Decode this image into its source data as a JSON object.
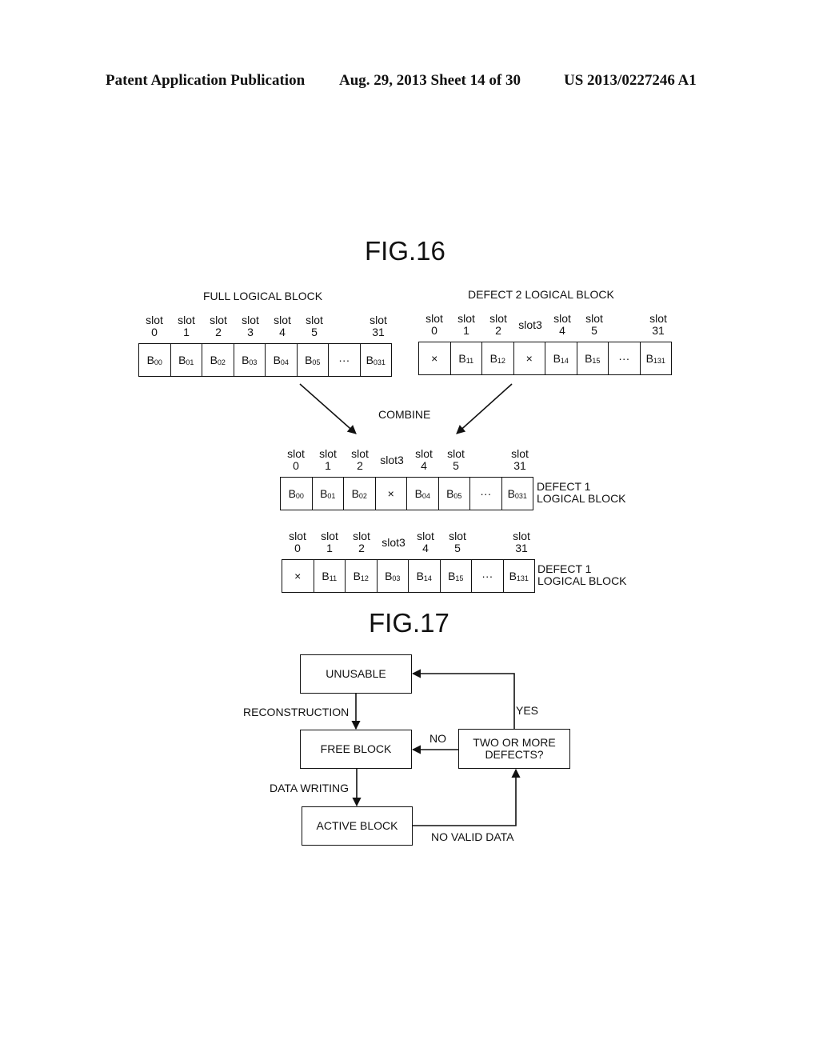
{
  "header": {
    "publication": "Patent Application Publication",
    "date_sheet": "Aug. 29, 2013  Sheet 14 of 30",
    "number": "US 2013/0227246 A1"
  },
  "fig16": {
    "title": "FIG.16",
    "combine_label": "COMBINE",
    "full_block": {
      "title": "FULL LOGICAL BLOCK",
      "slots": [
        [
          "slot",
          "0"
        ],
        [
          "slot",
          "1"
        ],
        [
          "slot",
          "2"
        ],
        [
          "slot",
          "3"
        ],
        [
          "slot",
          "4"
        ],
        [
          "slot",
          "5"
        ],
        [
          "",
          ""
        ],
        [
          "slot",
          "31"
        ]
      ],
      "cells": [
        [
          "B",
          "00"
        ],
        [
          "B",
          "01"
        ],
        [
          "B",
          "02"
        ],
        [
          "B",
          "03"
        ],
        [
          "B",
          "04"
        ],
        [
          "B",
          "05"
        ],
        [
          "···",
          ""
        ],
        [
          "B",
          "031"
        ]
      ]
    },
    "defect2_block": {
      "title": "DEFECT 2 LOGICAL BLOCK",
      "slots": [
        [
          "slot",
          "0"
        ],
        [
          "slot",
          "1"
        ],
        [
          "slot",
          "2"
        ],
        [
          "slot3",
          ""
        ],
        [
          "slot",
          "4"
        ],
        [
          "slot",
          "5"
        ],
        [
          "",
          ""
        ],
        [
          "slot",
          "31"
        ]
      ],
      "cells": [
        [
          "×",
          ""
        ],
        [
          "B",
          "11"
        ],
        [
          "B",
          "12"
        ],
        [
          "×",
          ""
        ],
        [
          "B",
          "14"
        ],
        [
          "B",
          "15"
        ],
        [
          "···",
          ""
        ],
        [
          "B",
          "131"
        ]
      ]
    },
    "result_block_1": {
      "side_label_1": "DEFECT 1",
      "side_label_2": "LOGICAL BLOCK",
      "slots": [
        [
          "slot",
          "0"
        ],
        [
          "slot",
          "1"
        ],
        [
          "slot",
          "2"
        ],
        [
          "slot3",
          ""
        ],
        [
          "slot",
          "4"
        ],
        [
          "slot",
          "5"
        ],
        [
          "",
          ""
        ],
        [
          "slot",
          "31"
        ]
      ],
      "cells": [
        [
          "B",
          "00"
        ],
        [
          "B",
          "01"
        ],
        [
          "B",
          "02"
        ],
        [
          "×",
          ""
        ],
        [
          "B",
          "04"
        ],
        [
          "B",
          "05"
        ],
        [
          "···",
          ""
        ],
        [
          "B",
          "031"
        ]
      ]
    },
    "result_block_2": {
      "side_label_1": "DEFECT 1",
      "side_label_2": "LOGICAL BLOCK",
      "slots": [
        [
          "slot",
          "0"
        ],
        [
          "slot",
          "1"
        ],
        [
          "slot",
          "2"
        ],
        [
          "slot3",
          ""
        ],
        [
          "slot",
          "4"
        ],
        [
          "slot",
          "5"
        ],
        [
          "",
          ""
        ],
        [
          "slot",
          "31"
        ]
      ],
      "cells": [
        [
          "×",
          ""
        ],
        [
          "B",
          "11"
        ],
        [
          "B",
          "12"
        ],
        [
          "B",
          "03"
        ],
        [
          "B",
          "14"
        ],
        [
          "B",
          "15"
        ],
        [
          "···",
          ""
        ],
        [
          "B",
          "131"
        ]
      ]
    }
  },
  "fig17": {
    "title": "FIG.17",
    "nodes": {
      "unusable": "UNUSABLE",
      "free_block": "FREE BLOCK",
      "active_block": "ACTIVE BLOCK",
      "decision_line1": "TWO OR MORE",
      "decision_line2": "DEFECTS?"
    },
    "edges": {
      "reconstruction": "RECONSTRUCTION",
      "data_writing": "DATA WRITING",
      "no_valid_data": "NO VALID DATA",
      "yes": "YES",
      "no": "NO"
    }
  }
}
